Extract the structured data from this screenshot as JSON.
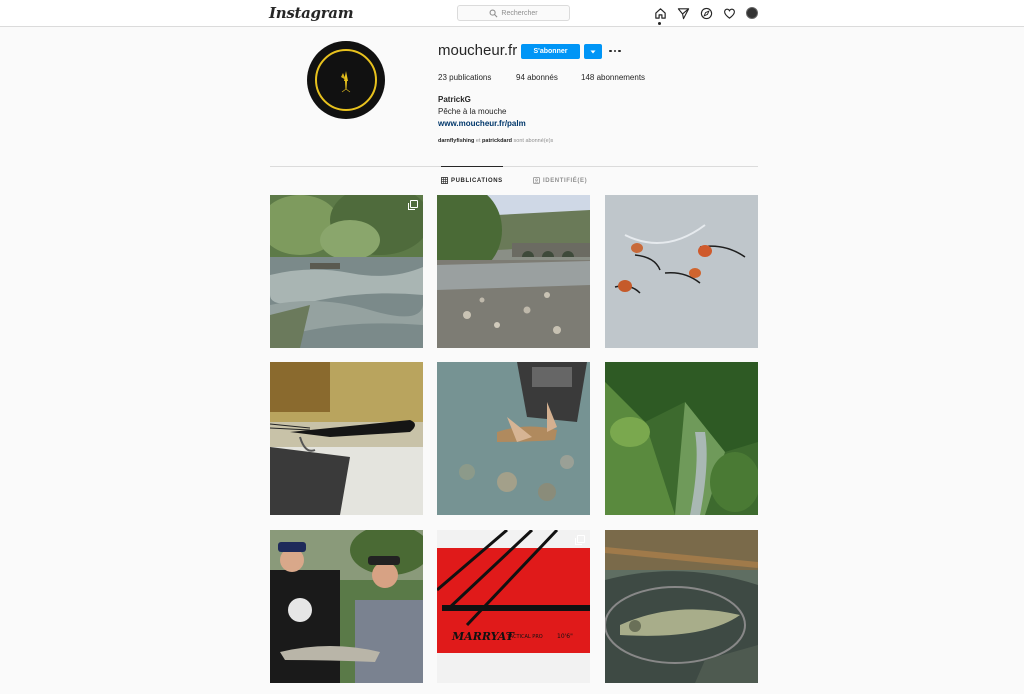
{
  "nav": {
    "logo": "Instagram",
    "search_placeholder": "Rechercher"
  },
  "profile": {
    "username": "moucheur.fr",
    "follow_label": "S'abonner",
    "posts_count": "23 publications",
    "followers_count": "94 abonnés",
    "following_count": "148 abonnements",
    "full_name": "PatrickG",
    "bio": "Pêche à la mouche",
    "website": "www.moucheur.fr/palm",
    "followed_by_1": "darnflyfishing",
    "followed_by_and": " et ",
    "followed_by_2": "patrickdard",
    "followed_by_suffix": " sont abonné(e)s"
  },
  "tabs": [
    {
      "label": "PUBLICATIONS",
      "active": true
    },
    {
      "label": "IDENTIFIÉ(E)",
      "active": false
    }
  ],
  "posts": [
    {
      "icon": "river-photo",
      "multi": true
    },
    {
      "icon": "bridge-river-photo",
      "multi": false
    },
    {
      "icon": "nymph-flies-photo",
      "multi": false
    },
    {
      "icon": "black-fly-vise-photo",
      "multi": false
    },
    {
      "icon": "trout-release-photo",
      "multi": false
    },
    {
      "icon": "mountain-valley-photo",
      "multi": false
    },
    {
      "icon": "anglers-fish-photo",
      "multi": false
    },
    {
      "icon": "fly-rod-photo",
      "multi": true
    },
    {
      "icon": "pike-net-photo",
      "multi": false
    }
  ],
  "colors": {
    "accent": "#0095f6",
    "link": "#00376b",
    "logo_ring": "#e8c21e"
  }
}
